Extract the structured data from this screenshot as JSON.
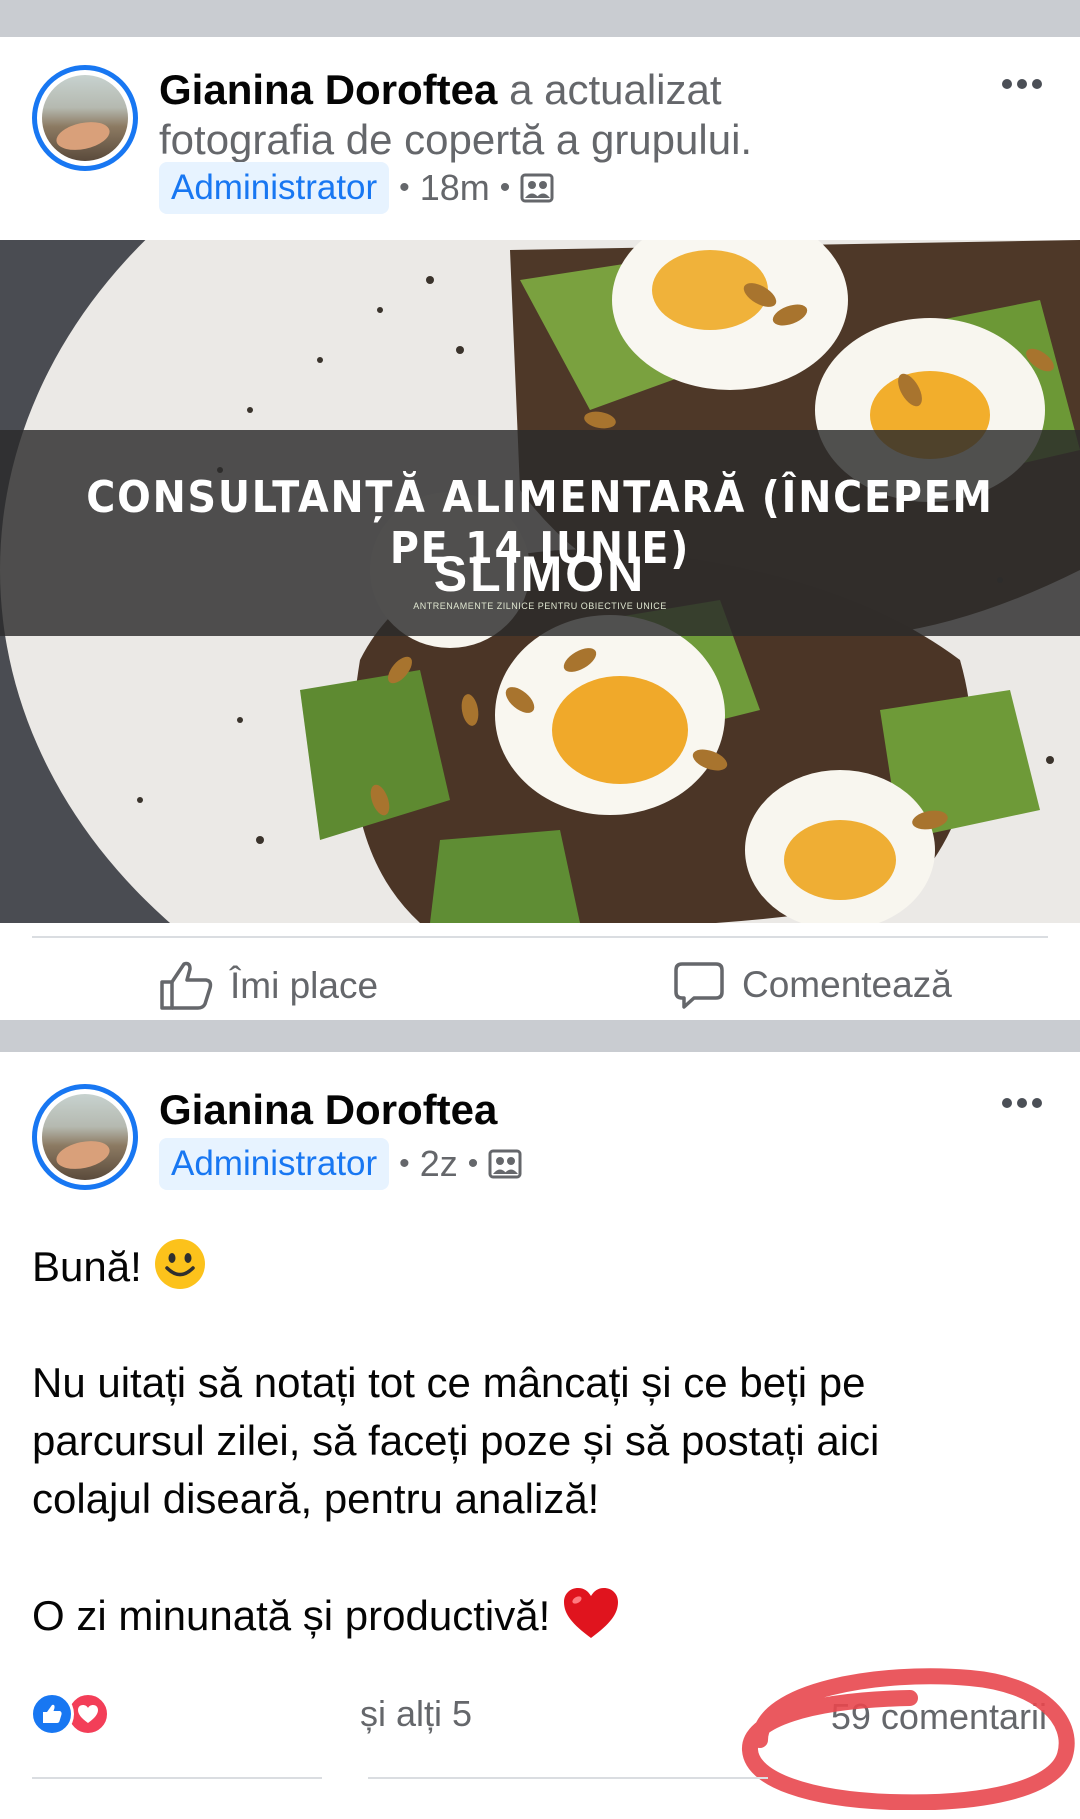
{
  "post1": {
    "author": "Gianina Doroftea",
    "action": "a actualizat fotografia de copertă a grupului.",
    "action_line1": "a actualizat",
    "action_line2": "fotografia de copertă a grupului.",
    "badge": "Administrator",
    "time": "18m",
    "audience_icon": "group-icon",
    "cover": {
      "banner_text": "CONSULTANȚĂ ALIMENTARĂ (ÎNCEPEM PE 14 IUNIE)",
      "logo_text": "SLIMON",
      "logo_tagline": "ANTRENAMENTE ZILNICE PENTRU OBIECTIVE UNICE"
    },
    "actions": {
      "like_label": "Îmi place",
      "comment_label": "Comentează"
    }
  },
  "post2": {
    "author": "Gianina Doroftea",
    "badge": "Administrator",
    "time": "2z",
    "audience_icon": "group-icon",
    "text": {
      "greeting": "Bună!",
      "paragraph1_line1": "Nu uitați să notați tot ce mâncați și ce beți pe",
      "paragraph1_line2": "parcursul zilei, să faceți poze și să postați aici",
      "paragraph1_line3": "colajul diseară, pentru analiză!",
      "closing": "O zi minunată și productivă!"
    },
    "reactions": {
      "icons": [
        "like-icon",
        "love-icon"
      ],
      "others": "și alți 5",
      "comments": "59 comentarii"
    }
  },
  "colors": {
    "accent": "#1877f2",
    "badge_bg": "#e7f3ff",
    "secondary_text": "#65676b",
    "annotation": "#e8474e",
    "separator": "#c9ccd1"
  }
}
